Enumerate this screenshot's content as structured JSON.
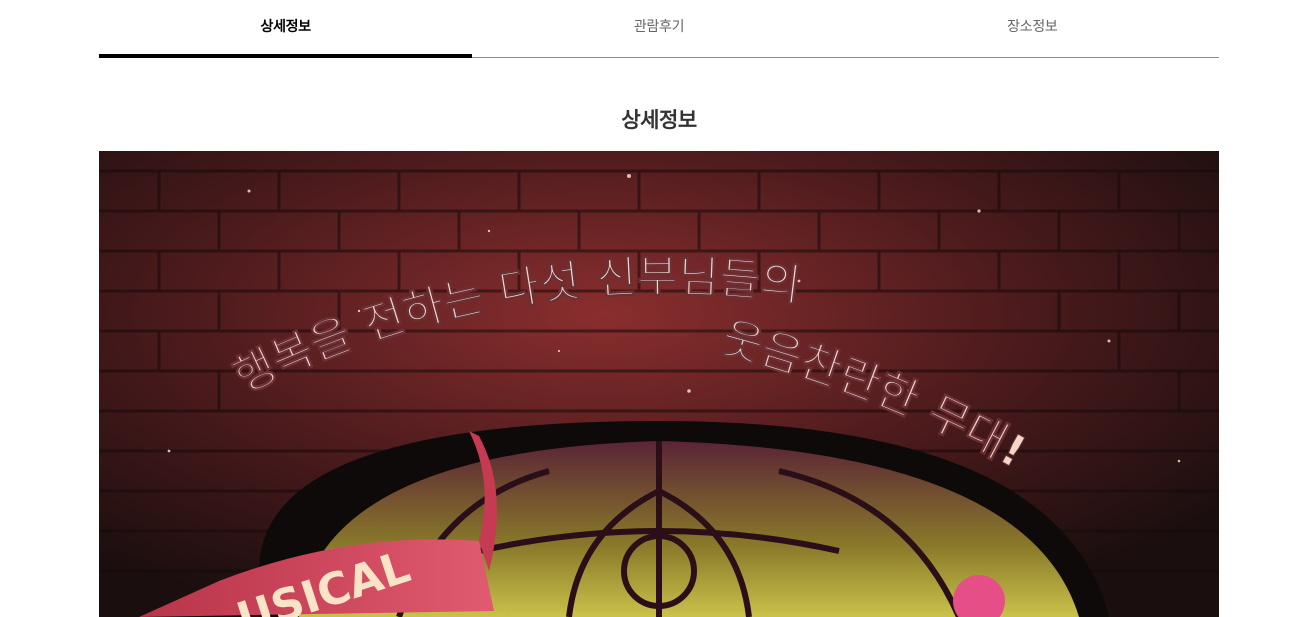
{
  "tabs": [
    {
      "label": "상세정보",
      "active": true
    },
    {
      "label": "관람후기",
      "active": false
    },
    {
      "label": "장소정보",
      "active": false
    }
  ],
  "section": {
    "title": "상세정보"
  },
  "poster": {
    "headline_line1": "행복을 전하는 다섯 신부님들의",
    "headline_line2": "웃음찬란한 무대!",
    "ribbon_text": "USICAL",
    "colors": {
      "background": "#241414",
      "text": "#f3d7c9",
      "ribbon": "#d94a62"
    }
  }
}
